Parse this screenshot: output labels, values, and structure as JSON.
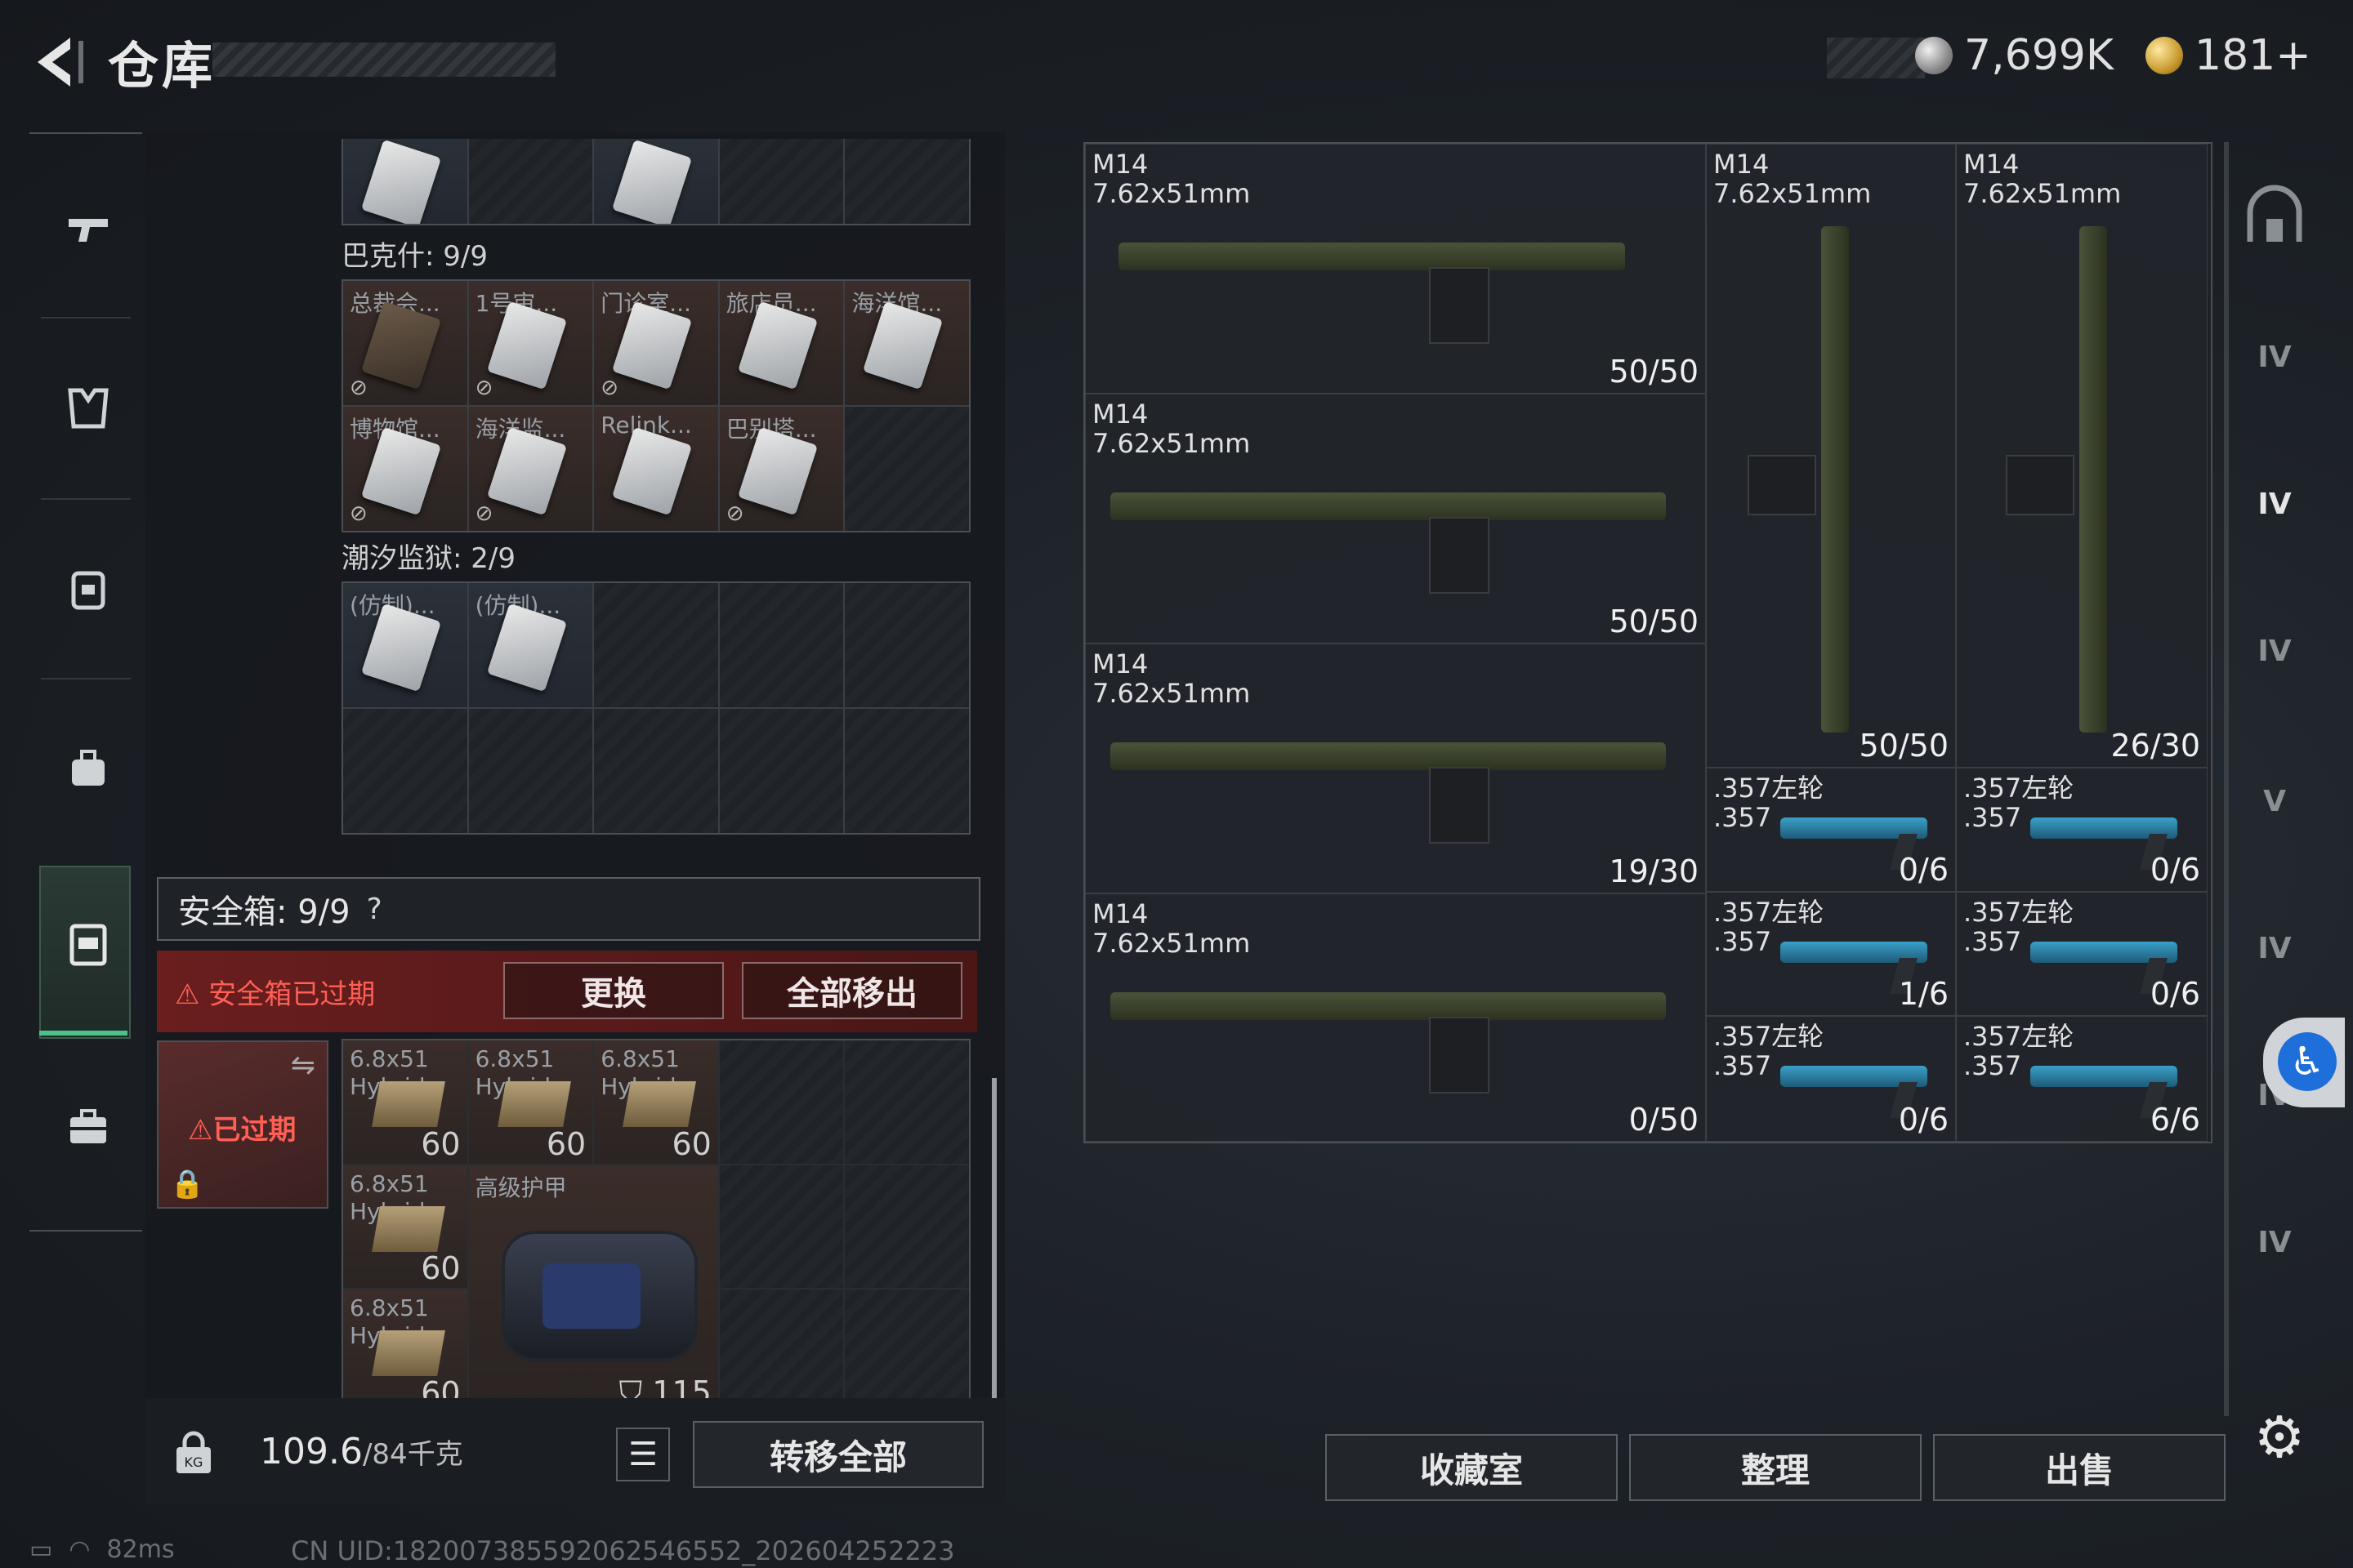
{
  "header": {
    "title": "仓库",
    "currency_silver": "7,699K",
    "currency_gold": "181+"
  },
  "storage": {
    "partial_section": {
      "cards": 2
    },
    "bakesh": {
      "label": "巴克什: 9/9",
      "items": [
        {
          "name": "总裁会...",
          "dark": true
        },
        {
          "name": "1号审..."
        },
        {
          "name": "门诊室..."
        },
        {
          "name": "旅店员..."
        },
        {
          "name": "海洋馆..."
        },
        {
          "name": "博物馆..."
        },
        {
          "name": "海洋监..."
        },
        {
          "name": "Relink..."
        },
        {
          "name": "巴别塔..."
        }
      ]
    },
    "tidal_prison": {
      "label": "潮汐监狱: 2/9",
      "items": [
        {
          "name": "(仿制)..."
        },
        {
          "name": "(仿制)..."
        }
      ]
    }
  },
  "safe_box": {
    "title": "安全箱: 9/9",
    "help": "?",
    "warning": "安全箱已过期",
    "replace_label": "更换",
    "remove_all_label": "全部移出",
    "expired_label": "已过期",
    "items": [
      {
        "name": "6.8x51\nHybrid",
        "count": "60"
      },
      {
        "name": "6.8x51\nHybrid",
        "count": "60"
      },
      {
        "name": "6.8x51\nHybrid",
        "count": "60"
      },
      {
        "name": "6.8x51\nHybrid",
        "count": "60"
      },
      {
        "name": "6.8x51\nHybrid",
        "count": "60"
      }
    ],
    "armor": {
      "name": "高级护甲",
      "durability": "115"
    }
  },
  "weight": {
    "current": "109.6",
    "max": "/84千克"
  },
  "transfer_all_label": "转移全部",
  "weapons": [
    {
      "name": "M14\n7.62x51mm",
      "count": "50/50"
    },
    {
      "name": "M14\n7.62x51mm",
      "count": "50/50"
    },
    {
      "name": "M14\n7.62x51mm",
      "count": "19/30"
    },
    {
      "name": "M14\n7.62x51mm",
      "count": "0/50"
    },
    {
      "name": "M14\n7.62x51mm",
      "count": "50/50"
    },
    {
      "name": "M14\n7.62x51mm",
      "count": "26/30"
    },
    {
      "name": ".357左轮\n.357",
      "count": "0/6"
    },
    {
      "name": ".357左轮\n.357",
      "count": "0/6"
    },
    {
      "name": ".357左轮\n.357",
      "count": "1/6"
    },
    {
      "name": ".357左轮\n.357",
      "count": "0/6"
    },
    {
      "name": ".357左轮\n.357",
      "count": "0/6"
    },
    {
      "name": ".357左轮\n.357",
      "count": "6/6"
    }
  ],
  "bottom_buttons": {
    "collection": "收藏室",
    "sort": "整理",
    "sell": "出售"
  },
  "right_nav_labels": [
    "IV",
    "IV",
    "IV",
    "V",
    "IV",
    "IV",
    "IV"
  ],
  "status": {
    "ping": "82ms",
    "uid": "CN UID:182007385592062546552_202604252223"
  },
  "colors": {
    "accent_green": "#4dc18c",
    "warning_red": "#ff5f55",
    "access_blue": "#1e6fd9"
  }
}
